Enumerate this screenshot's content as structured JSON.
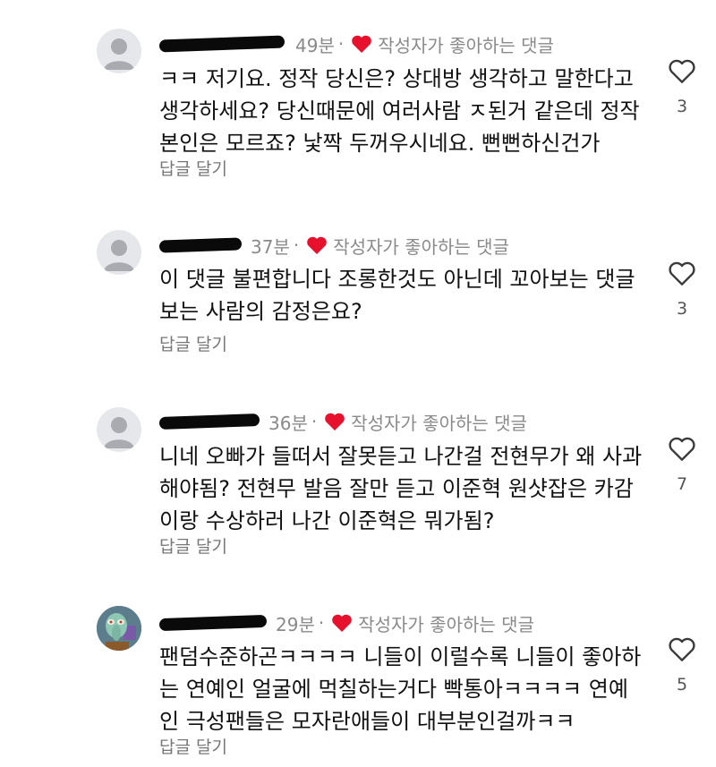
{
  "comments": [
    {
      "time": "49분",
      "sep": "·",
      "author_like_label": "작성자가 좋아하는 댓글",
      "text": "ㅋㅋ 저기요. 정작 당신은? 상대방 생각하고 말한다고\n생각하세요? 당신때문에 여러사람 ㅈ된거 같은데 정작\n본인은 모르죠? 낯짝 두꺼우시네요. 뻔뻔하신건가",
      "reply_label": "답글 달기",
      "likes": "3"
    },
    {
      "time": "37분",
      "sep": "·",
      "author_like_label": "작성자가 좋아하는 댓글",
      "text": "이 댓글 불편합니다 조롱한것도 아닌데 꼬아보는 댓글\n보는 사람의 감정은요?",
      "reply_label": "답글 달기",
      "likes": "3"
    },
    {
      "time": "36분",
      "sep": "·",
      "author_like_label": "작성자가 좋아하는 댓글",
      "text": "니네 오빠가 들떠서 잘못듣고 나간걸 전현무가 왜 사과\n해야됨? 전현무 발음 잘만 듣고 이준혁 원샷잡은 카감\n이랑 수상하러 나간 이준혁은 뭐가됨?",
      "reply_label": "답글 달기",
      "likes": "7"
    },
    {
      "time": "29분",
      "sep": "·",
      "author_like_label": "작성자가 좋아하는 댓글",
      "text": "팬덤수준하곤ㅋㅋㅋㅋ 니들이 이럴수록 니들이 좋아하\n는 연예인 얼굴에 먹칠하는거다 빡통아ㅋㅋㅋㅋ 연예\n인 극성팬들은 모자란애들이 대부분인걸까ㅋㅋ",
      "reply_label": "답글 달기",
      "likes": "5"
    }
  ],
  "colors": {
    "heart_red": "#e8112d",
    "meta_gray": "#8a8a8a",
    "avatar_bg": "#e6e7ea"
  },
  "icons": [
    "default-avatar-icon",
    "cartoon-avatar-icon",
    "heart-filled-icon",
    "heart-outline-icon"
  ]
}
